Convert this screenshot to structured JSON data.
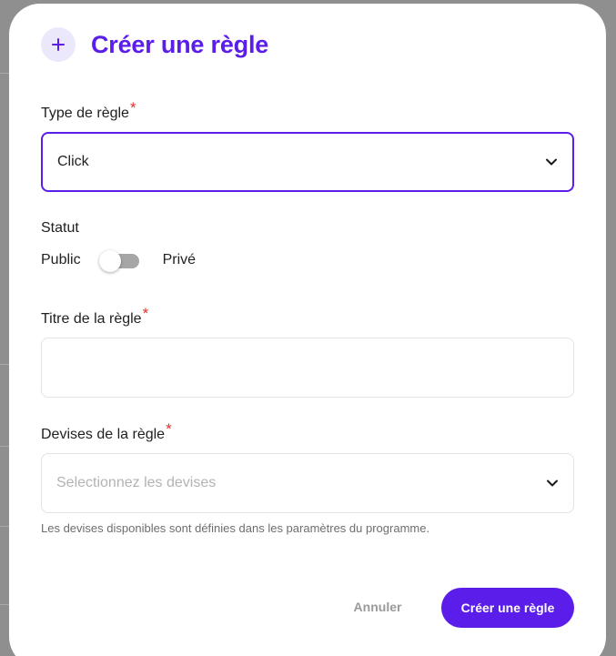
{
  "modal": {
    "title": "Créer une règle",
    "icon": "plus-icon",
    "accent_color": "#5b1de9"
  },
  "rule_type": {
    "label": "Type de règle",
    "required_mark": "*",
    "value": "Click"
  },
  "status": {
    "label": "Statut",
    "left_option": "Public",
    "right_option": "Privé",
    "toggle_on": false
  },
  "rule_title": {
    "label": "Titre de la règle",
    "required_mark": "*",
    "value": ""
  },
  "currencies": {
    "label": "Devises de la règle",
    "required_mark": "*",
    "placeholder": "Selectionnez les devises",
    "helper": "Les devises disponibles sont définies dans les paramètres du programme."
  },
  "actions": {
    "cancel_label": "Annuler",
    "submit_label": "Créer une règle"
  }
}
